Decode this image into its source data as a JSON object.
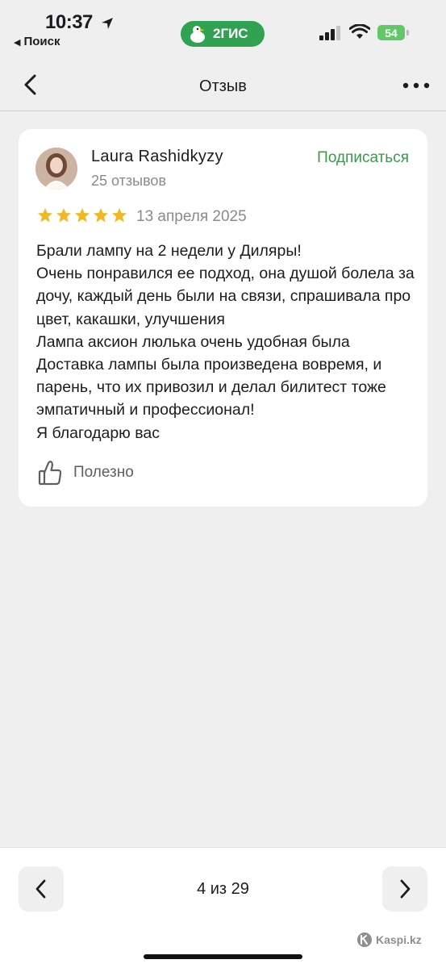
{
  "status_bar": {
    "time": "10:37",
    "back_app": "Поиск",
    "app_badge": "2ГИС",
    "battery": "54"
  },
  "nav": {
    "title": "Отзыв"
  },
  "review": {
    "author": "Laura Rashidkyzy",
    "review_count": "25 отзывов",
    "subscribe_label": "Подписаться",
    "rating": 5,
    "date": "13 апреля 2025",
    "text": "Брали лампу на 2 недели у Диляры!\nОчень понравился ее подход, она душой болела за дочу, каждый день были на связи, спрашивала про цвет, какашки, улучшения\nЛампа аксион люлька очень удобная была\nДоставка лампы была произведена вовремя, и парень, что их привозил и делал билитест тоже эмпатичный и профессионал!\nЯ благодарю вас",
    "helpful_label": "Полезно"
  },
  "pager": {
    "text": "4 из 29"
  },
  "watermark": "Kaspi.kz",
  "colors": {
    "accent_green": "#3a9a4a",
    "star": "#f2b824",
    "background": "#efeff0"
  }
}
